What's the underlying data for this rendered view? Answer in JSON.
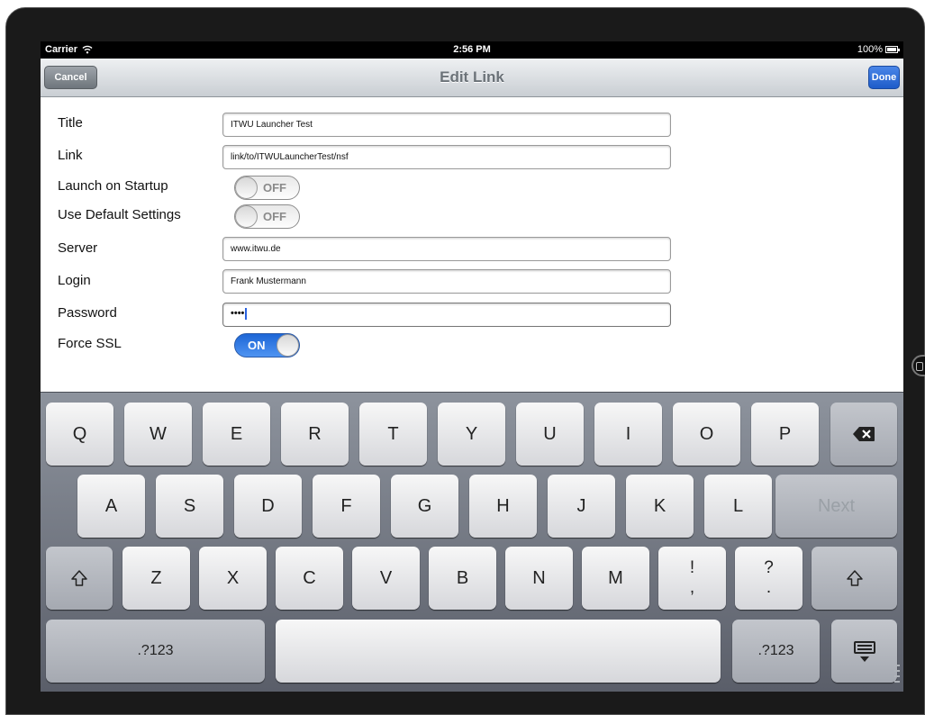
{
  "status_bar": {
    "carrier": "Carrier",
    "time": "2:56 PM",
    "battery": "100%"
  },
  "nav": {
    "cancel_label": "Cancel",
    "title": "Edit Link",
    "done_label": "Done"
  },
  "form": {
    "title_label": "Title",
    "title_value": "ITWU Launcher Test",
    "link_label": "Link",
    "link_value": "link/to/ITWULauncherTest/nsf",
    "launch_label": "Launch on Startup",
    "launch_state": "OFF",
    "default_label": "Use Default Settings",
    "default_state": "OFF",
    "server_label": "Server",
    "server_value": "www.itwu.de",
    "login_label": "Login",
    "login_value": "Frank Mustermann",
    "password_label": "Password",
    "password_value": "••••",
    "ssl_label": "Force SSL",
    "ssl_state": "ON"
  },
  "keyboard": {
    "row1": [
      "Q",
      "W",
      "E",
      "R",
      "T",
      "Y",
      "U",
      "I",
      "O",
      "P"
    ],
    "row2": [
      "A",
      "S",
      "D",
      "F",
      "G",
      "H",
      "J",
      "K",
      "L"
    ],
    "next_label": "Next",
    "row3": [
      "Z",
      "X",
      "C",
      "V",
      "B",
      "N",
      "M"
    ],
    "punct1": {
      "top": "!",
      "bottom": ","
    },
    "punct2": {
      "top": "?",
      "bottom": "."
    },
    "numbers_label": ".?123",
    "icons": {
      "backspace": "backspace-icon",
      "shift": "shift-icon",
      "dismiss": "keyboard-dismiss-icon"
    }
  }
}
